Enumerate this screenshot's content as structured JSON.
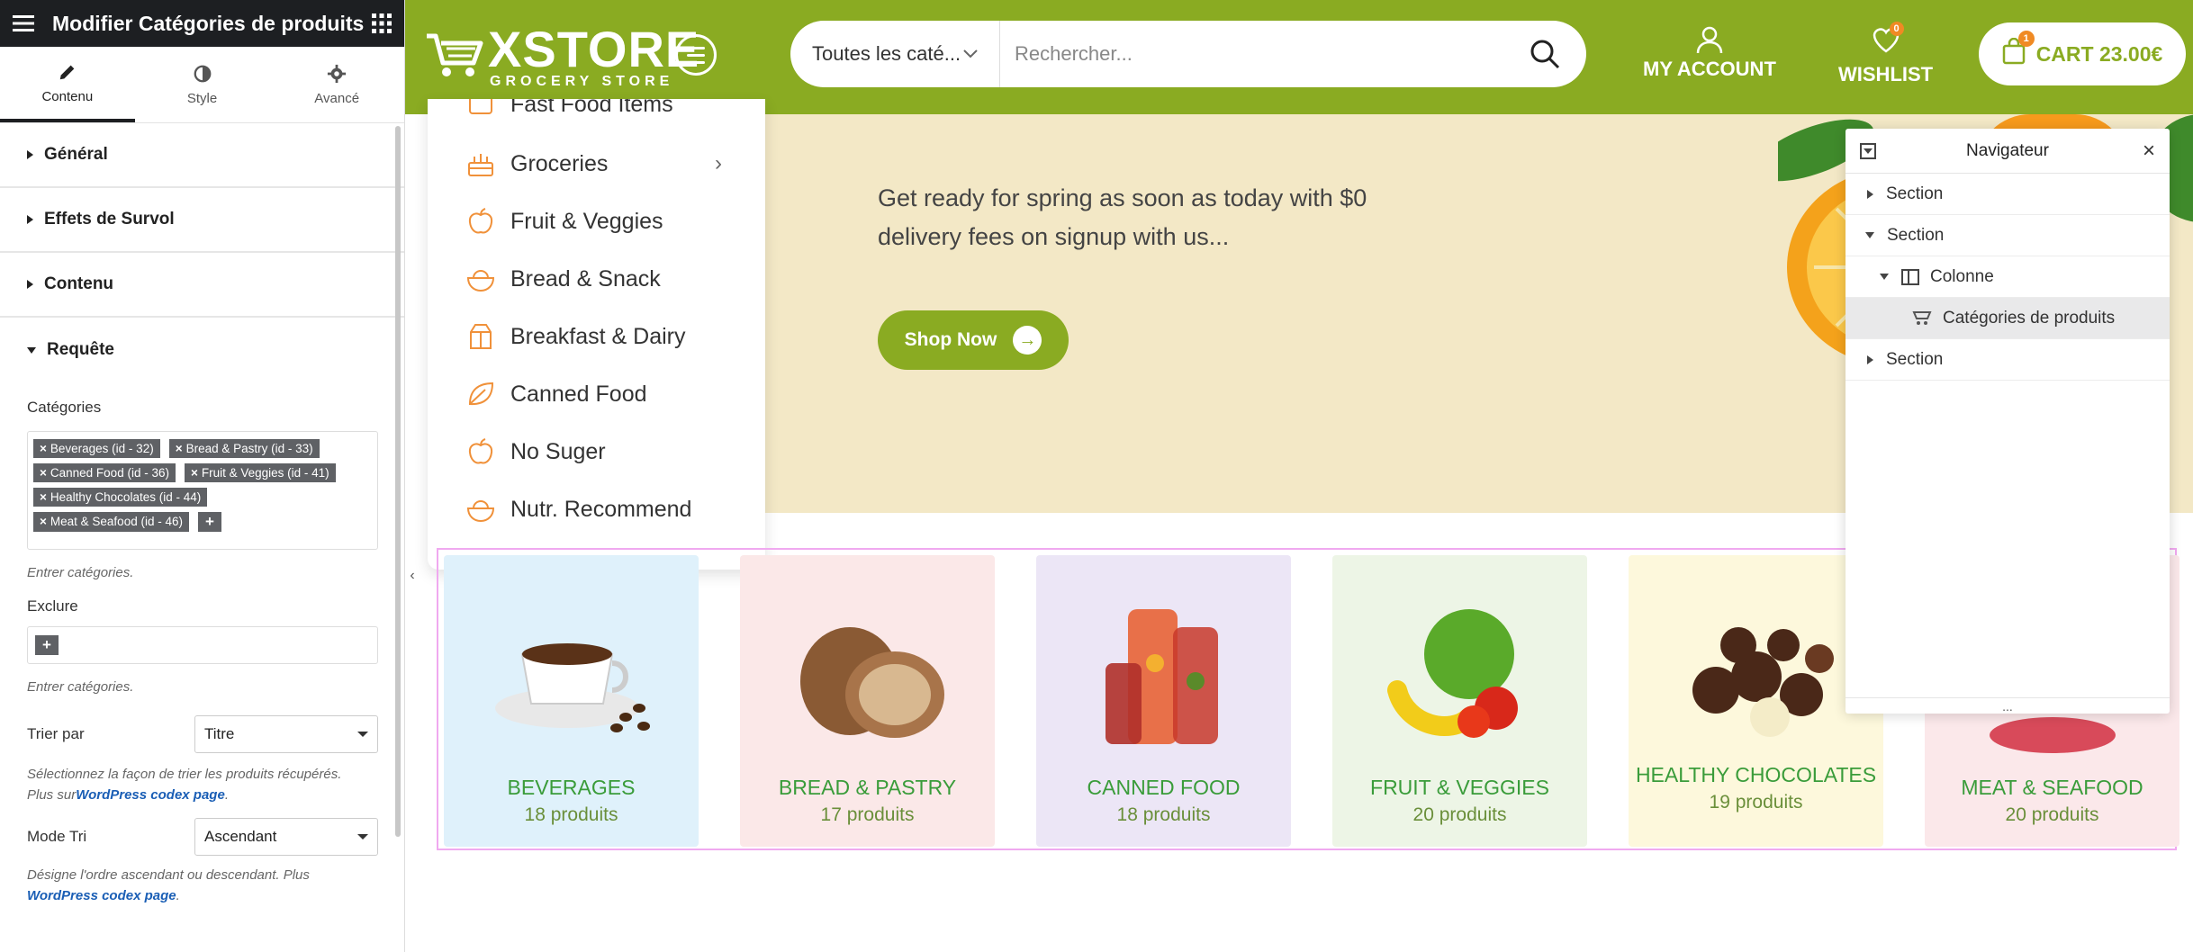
{
  "editor": {
    "title": "Modifier Catégories de produits",
    "tabs": [
      {
        "label": "Contenu",
        "icon": "pencil-icon"
      },
      {
        "label": "Style",
        "icon": "half-circle-icon"
      },
      {
        "label": "Avancé",
        "icon": "gear-icon"
      }
    ],
    "sections": {
      "general": "Général",
      "hover": "Effets de Survol",
      "content": "Contenu",
      "query": "Requête"
    },
    "categories_label": "Catégories",
    "selected_tags": [
      "Beverages (id - 32)",
      "Bread & Pastry (id - 33)",
      "Canned Food (id - 36)",
      "Fruit & Veggies (id - 41)",
      "Healthy Chocolates (id - 44)",
      "Meat & Seafood (id - 46)"
    ],
    "enter_categories_hint": "Entrer catégories.",
    "exclude_label": "Exclure",
    "exclude_hint": "Entrer catégories.",
    "sort_by_label": "Trier par",
    "sort_by_value": "Titre",
    "sort_hint_1": "Sélectionnez la façon de trier les produits récupérés.",
    "sort_hint_2_prefix": "Plus sur",
    "codex_link": "WordPress codex page",
    "order_label": "Mode Tri",
    "order_value": "Ascendant",
    "order_hint": "Désigne l'ordre ascendant ou descendant. Plus",
    "codex_link_2": "WordPress codex page"
  },
  "site": {
    "logo_main": "XSTORE",
    "logo_sub": "GROCERY STORE",
    "search_category": "Toutes les caté...",
    "search_placeholder": "Rechercher...",
    "account_label": "MY ACCOUNT",
    "wishlist_label": "WISHLIST",
    "wishlist_count": "0",
    "cart_label": "CART 23.00€",
    "cart_count": "1",
    "accent_color": "#8aab22"
  },
  "hero": {
    "text": "Get ready for spring as soon as today with $0 delivery fees on signup with us...",
    "button": "Shop Now"
  },
  "category_menu": [
    {
      "label": "Fast Food Items",
      "icon": "fastfood-icon"
    },
    {
      "label": "Groceries",
      "icon": "cake-icon",
      "has_submenu": true
    },
    {
      "label": "Fruit & Veggies",
      "icon": "apple-icon"
    },
    {
      "label": "Bread & Snack",
      "icon": "bowl-icon"
    },
    {
      "label": "Breakfast & Dairy",
      "icon": "milk-box-icon"
    },
    {
      "label": "Canned Food",
      "icon": "leaf-icon"
    },
    {
      "label": "No Suger",
      "icon": "apple-icon"
    },
    {
      "label": "Nutr. Recommend",
      "icon": "bowl-icon"
    }
  ],
  "categories": [
    {
      "name": "BEVERAGES",
      "count": "18 produits",
      "bg": "#dff1fb"
    },
    {
      "name": "BREAD & PASTRY",
      "count": "17 produits",
      "bg": "#fbe8e8"
    },
    {
      "name": "CANNED FOOD",
      "count": "18 produits",
      "bg": "#ece6f6"
    },
    {
      "name": "FRUIT & VEGGIES",
      "count": "20 produits",
      "bg": "#edf5e6"
    },
    {
      "name": "HEALTHY CHOCOLATES",
      "count": "19 produits",
      "bg": "#fdf8dc"
    },
    {
      "name": "MEAT & SEAFOOD",
      "count": "20 produits",
      "bg": "#fbe8ea"
    }
  ],
  "navigator": {
    "title": "Navigateur",
    "rows": [
      {
        "label": "Section",
        "expanded": false
      },
      {
        "label": "Section",
        "expanded": true
      },
      {
        "label": "Colonne",
        "expanded": true
      },
      {
        "label": "Catégories de produits",
        "selected": true
      },
      {
        "label": "Section",
        "expanded": false
      }
    ],
    "footer": "..."
  }
}
